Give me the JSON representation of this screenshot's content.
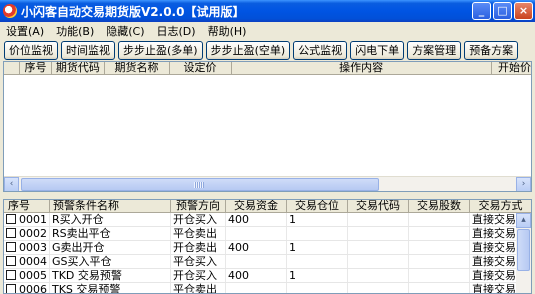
{
  "window": {
    "title": "小闪客自动交易期货版V2.0.0【试用版】",
    "minimize": "_",
    "maximize": "□",
    "close": "×"
  },
  "menu": [
    "设置(A)",
    "功能(B)",
    "隐藏(C)",
    "日志(D)",
    "帮助(H)"
  ],
  "toolbar": [
    "价位监视",
    "时间监视",
    "步步止盈(多单)",
    "步步止盈(空单)",
    "公式监视",
    "闪电下单",
    "方案管理",
    "预备方案"
  ],
  "upper_grid": {
    "columns": [
      "序号",
      "期货代码",
      "期货名称",
      "设定价",
      "操作内容",
      "开始价"
    ],
    "scroll_left": "‹",
    "scroll_right": "›"
  },
  "lower_grid": {
    "columns": [
      "序号",
      "预警条件名称",
      "预警方向",
      "交易资金",
      "交易仓位",
      "交易代码",
      "交易股数",
      "交易方式"
    ],
    "rows": [
      {
        "id": "0001",
        "name": "R买入开仓",
        "dir": "开仓买入",
        "fund": "400",
        "pos": "1",
        "code": "",
        "qty": "",
        "mode": "直接交易"
      },
      {
        "id": "0002",
        "name": "RS卖出平仓",
        "dir": "平仓卖出",
        "fund": "",
        "pos": "",
        "code": "",
        "qty": "",
        "mode": "直接交易"
      },
      {
        "id": "0003",
        "name": "G卖出开仓",
        "dir": "开仓卖出",
        "fund": "400",
        "pos": "1",
        "code": "",
        "qty": "",
        "mode": "直接交易"
      },
      {
        "id": "0004",
        "name": "GS买入平仓",
        "dir": "平仓买入",
        "fund": "",
        "pos": "",
        "code": "",
        "qty": "",
        "mode": "直接交易"
      },
      {
        "id": "0005",
        "name": "TKD 交易预警",
        "dir": "开仓买入",
        "fund": "400",
        "pos": "1",
        "code": "",
        "qty": "",
        "mode": "直接交易"
      },
      {
        "id": "0006",
        "name": "TKS 交易预警",
        "dir": "平仓卖出",
        "fund": "",
        "pos": "",
        "code": "",
        "qty": "",
        "mode": "直接交易"
      }
    ]
  },
  "colors": {
    "titlebar": "#0054e3",
    "window_bg": "#ece9d8",
    "grid_border": "#7f9db9"
  }
}
